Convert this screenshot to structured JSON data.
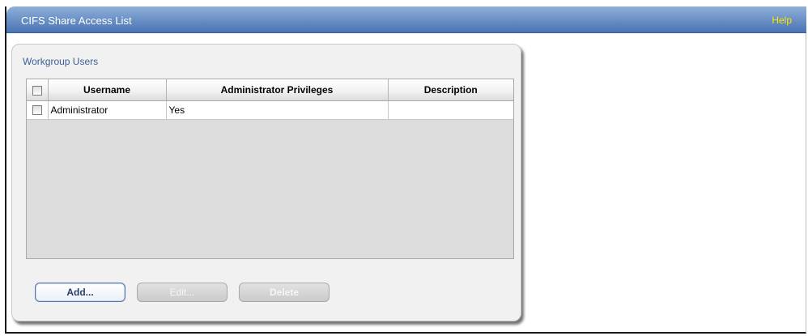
{
  "window": {
    "title": "CIFS Share Access List",
    "help_label": "Help"
  },
  "panel": {
    "heading": "Workgroup Users"
  },
  "table": {
    "columns": [
      "Username",
      "Administrator Privileges",
      "Description"
    ],
    "rows": [
      {
        "username": "Administrator",
        "admin": "Yes",
        "description": "",
        "checked": false
      }
    ]
  },
  "buttons": {
    "add": "Add...",
    "edit": "Edit...",
    "delete": "Delete"
  },
  "colors": {
    "titlebar": "#4a73b2",
    "help_link": "#ffe600",
    "heading": "#3c5f97"
  }
}
